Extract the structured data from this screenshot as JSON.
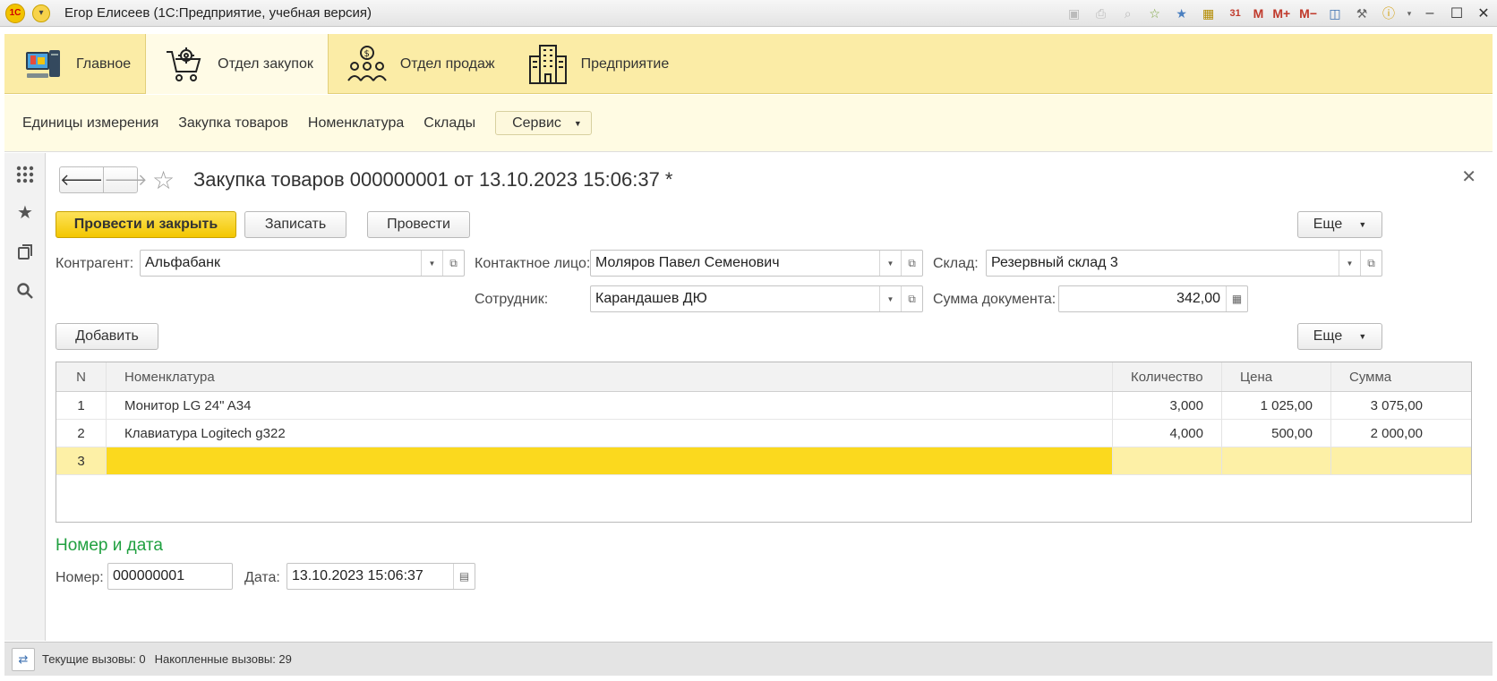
{
  "window": {
    "app_logo": "1С",
    "title": "Егор Елисеев  (1С:Предприятие, учебная версия)"
  },
  "sections": [
    {
      "label": "Главное",
      "icon": "computer-icon"
    },
    {
      "label": "Отдел закупок",
      "icon": "cart-gear-icon"
    },
    {
      "label": "Отдел продаж",
      "icon": "people-money-icon"
    },
    {
      "label": "Предприятие",
      "icon": "building-icon"
    }
  ],
  "commands": {
    "items": [
      "Единицы измерения",
      "Закупка товаров",
      "Номенклатура",
      "Склады"
    ],
    "service": "Сервис"
  },
  "form": {
    "title": "Закупка товаров 000000001 от 13.10.2023 15:06:37 *",
    "buttons": {
      "post_close": "Провести и закрыть",
      "save": "Записать",
      "post": "Провести",
      "more": "Еще",
      "add": "Добавить",
      "more2": "Еще"
    },
    "fields": {
      "counterparty_label": "Контрагент:",
      "counterparty": "Альфабанк",
      "contact_label": "Контактное лицо:",
      "contact": "Моляров Павел Семенович",
      "warehouse_label": "Склад:",
      "warehouse": "Резервный склад 3",
      "employee_label": "Сотрудник:",
      "employee": "Карандашев ДЮ",
      "sum_label": "Сумма документа:",
      "sum": "342,00"
    },
    "table": {
      "columns": [
        "N",
        "Номенклатура",
        "Количество",
        "Цена",
        "Сумма"
      ],
      "rows": [
        {
          "n": "1",
          "item": "Монитор LG 24\" A34",
          "qty": "3,000",
          "price": "1 025,00",
          "sum": "3 075,00"
        },
        {
          "n": "2",
          "item": "Клавиатура Logitech g322",
          "qty": "4,000",
          "price": "500,00",
          "sum": "2 000,00"
        },
        {
          "n": "3",
          "item": "",
          "qty": "",
          "price": "",
          "sum": ""
        }
      ]
    },
    "number_date": {
      "group_title": "Номер и дата",
      "number_label": "Номер:",
      "number": "000000001",
      "date_label": "Дата:",
      "date": "13.10.2023 15:06:37"
    }
  },
  "status": {
    "current_calls": "Текущие вызовы: 0",
    "accumulated_calls": "Накопленные вызовы: 29"
  },
  "colors": {
    "accent_yellow": "#f3c700",
    "section_bg": "#fbeca6",
    "group_title_green": "#20a040"
  }
}
